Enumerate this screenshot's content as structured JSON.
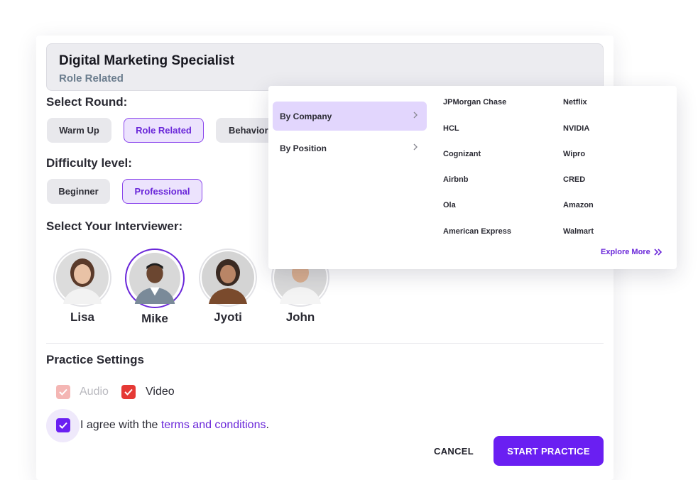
{
  "job": {
    "title": "Digital Marketing Specialist",
    "subtitle": "Role Related"
  },
  "round": {
    "label": "Select Round:",
    "options": [
      "Warm Up",
      "Role Related",
      "Behavioral"
    ],
    "selected": "Role Related"
  },
  "difficulty": {
    "label": "Difficulty level:",
    "options": [
      "Beginner",
      "Professional"
    ],
    "selected": "Professional"
  },
  "interviewer": {
    "label": "Select Your Interviewer:",
    "people": [
      {
        "name": "Lisa",
        "icon": "avatar-lisa-icon"
      },
      {
        "name": "Mike",
        "icon": "avatar-mike-icon"
      },
      {
        "name": "Jyoti",
        "icon": "avatar-jyoti-icon"
      },
      {
        "name": "John",
        "icon": "avatar-john-icon"
      }
    ],
    "selected": "Mike"
  },
  "settings": {
    "label": "Practice Settings",
    "audio": {
      "label": "Audio",
      "checked": true,
      "disabled": true
    },
    "video": {
      "label": "Video",
      "checked": true
    }
  },
  "agree": {
    "prefix": "I agree with the ",
    "link": "terms and conditions",
    "suffix": ".",
    "checked": true
  },
  "actions": {
    "cancel": "CANCEL",
    "start": "START PRACTICE"
  },
  "dropdown": {
    "menu": [
      {
        "label": "By Company",
        "active": true
      },
      {
        "label": "By Position",
        "active": false
      }
    ],
    "companies_col1": [
      "JPMorgan Chase",
      "HCL",
      "Cognizant",
      "Airbnb",
      "Ola",
      "American Express"
    ],
    "companies_col2": [
      "Netflix",
      "NVIDIA",
      "Wipro",
      "CRED",
      "Amazon",
      "Walmart"
    ],
    "explore": "Explore More"
  },
  "colors": {
    "accent": "#6a1ff2",
    "accent_text": "#6a27d9",
    "selected_bg": "#ece3fd",
    "checkbox_red": "#e53935",
    "checkbox_red_disabled": "#f4b6b4"
  }
}
